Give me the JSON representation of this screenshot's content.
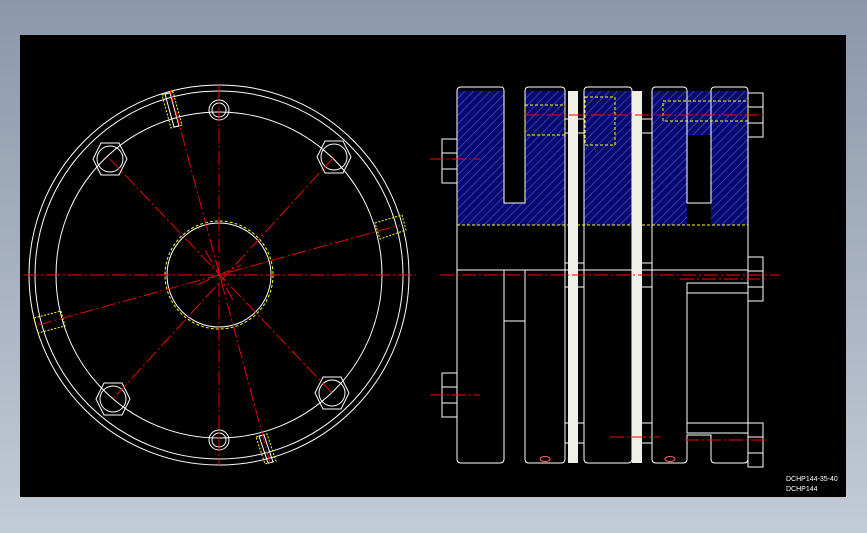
{
  "drawing": {
    "title_lines": [
      "DCHP144-35-40",
      "DCHP144"
    ],
    "background_color": "#000000",
    "line_color": "#ffffff",
    "centerline_color": "#ff0000",
    "hidden_line_color": "#ffff00",
    "section_fill_color": "#0a0a6e",
    "hatch_color": "#3a4fd8",
    "spacer_color": "#f0f0e6"
  }
}
